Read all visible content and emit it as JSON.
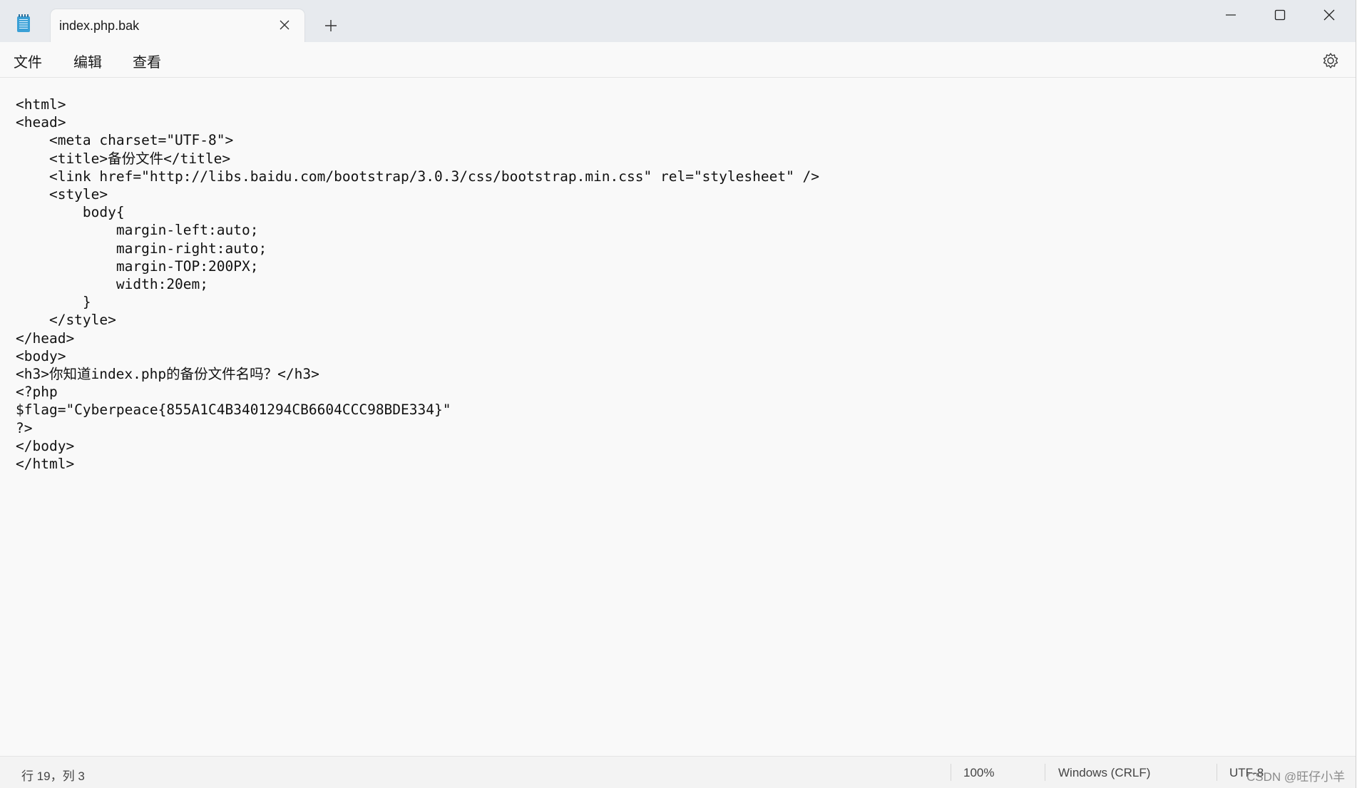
{
  "tab": {
    "title": "index.php.bak"
  },
  "menu": {
    "file": "文件",
    "edit": "编辑",
    "view": "查看"
  },
  "editor": {
    "content": "<html>\n<head>\n    <meta charset=\"UTF-8\">\n    <title>备份文件</title>\n    <link href=\"http://libs.baidu.com/bootstrap/3.0.3/css/bootstrap.min.css\" rel=\"stylesheet\" />\n    <style>\n        body{\n            margin-left:auto;\n            margin-right:auto;\n            margin-TOP:200PX;\n            width:20em;\n        }\n    </style>\n</head>\n<body>\n<h3>你知道index.php的备份文件名吗？</h3>\n<?php\n$flag=\"Cyberpeace{855A1C4B3401294CB6604CCC98BDE334}\"\n?>\n</body>\n</html>"
  },
  "status": {
    "position": "行 19，列 3",
    "zoom": "100%",
    "line_ending": "Windows (CRLF)",
    "encoding": "UTF-8"
  },
  "watermark": "CSDN @旺仔小羊",
  "icons": {
    "app": "notepad-icon",
    "tab_close": "close-icon",
    "new_tab": "plus-icon",
    "minimize": "minimize-icon",
    "maximize": "maximize-icon",
    "close": "close-icon",
    "settings": "gear-icon"
  }
}
